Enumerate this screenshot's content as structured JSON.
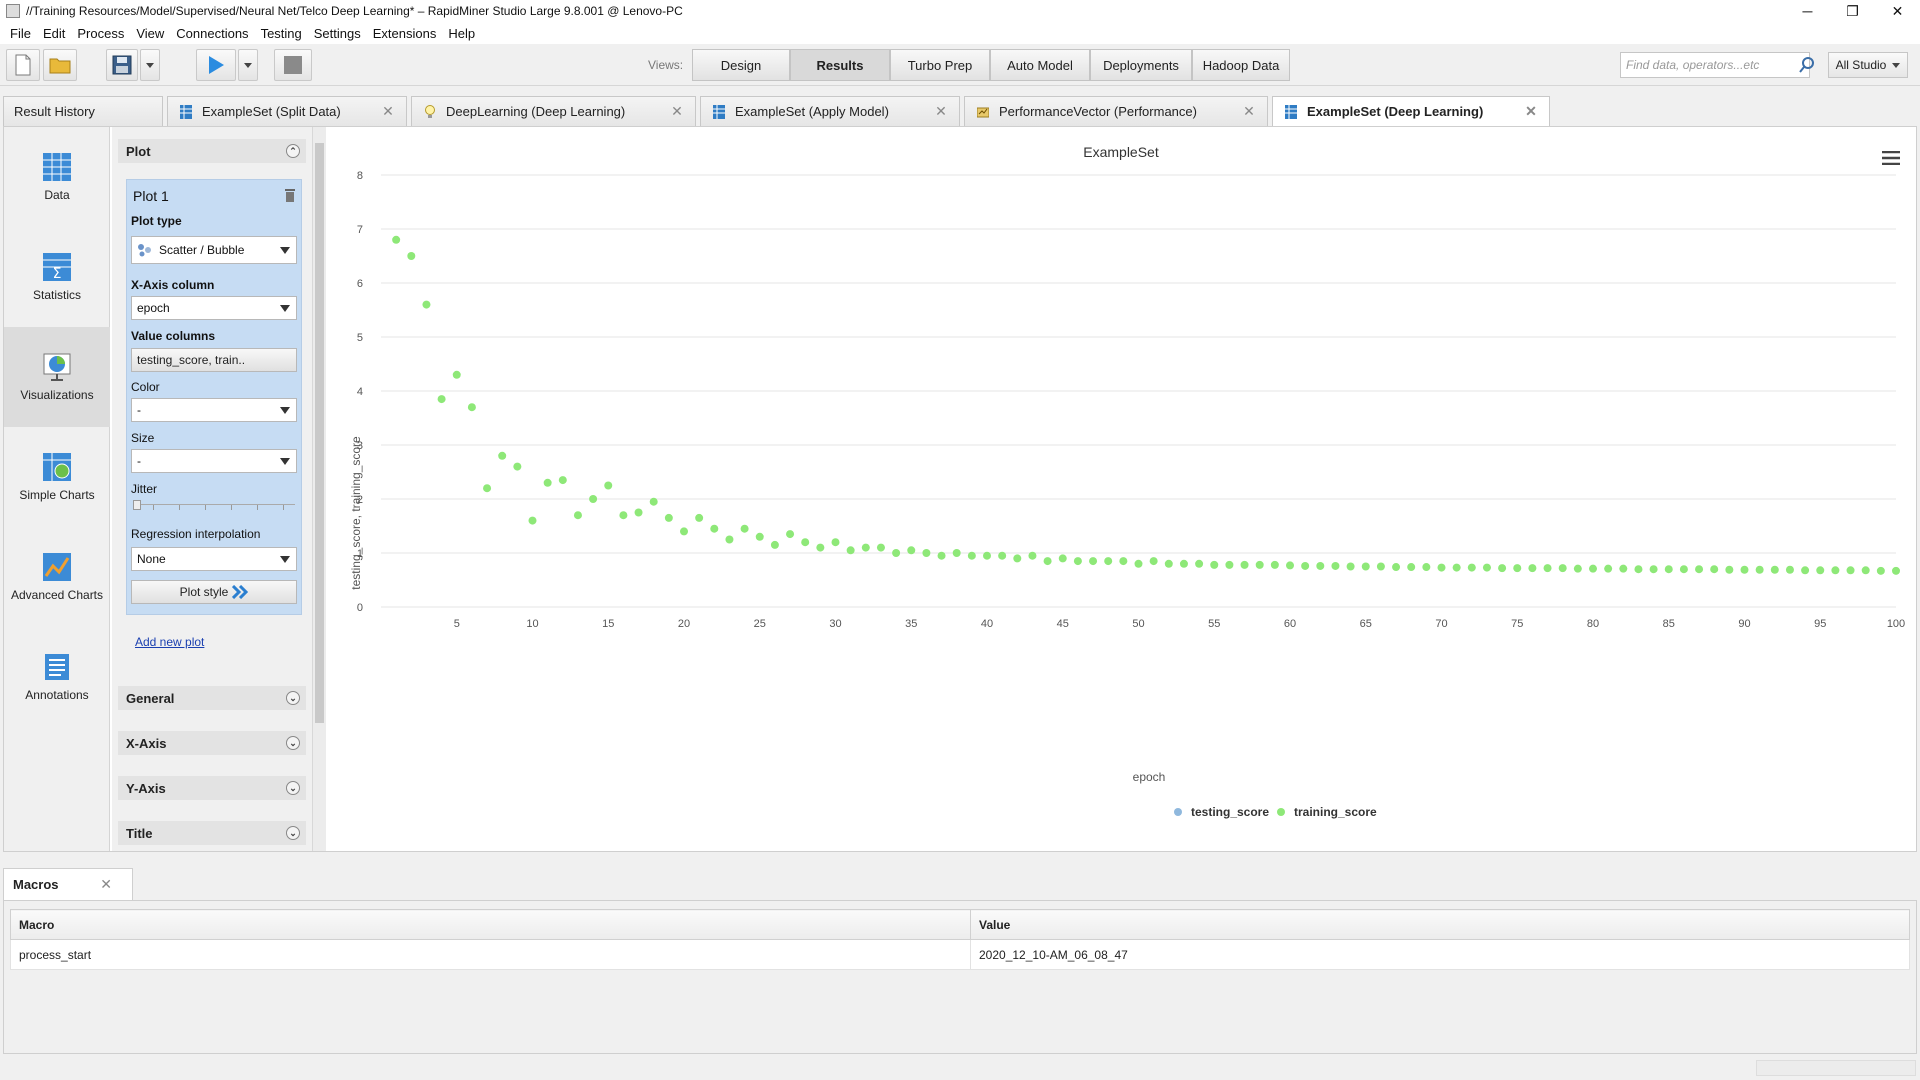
{
  "window": {
    "title": "//Training Resources/Model/Supervised/Neural Net/Telco Deep Learning* – RapidMiner Studio Large 9.8.001 @ Lenovo-PC",
    "minimize": "─",
    "maximize": "❐",
    "close": "✕"
  },
  "menu": [
    "File",
    "Edit",
    "Process",
    "View",
    "Connections",
    "Testing",
    "Settings",
    "Extensions",
    "Help"
  ],
  "toolbar": {
    "views_label": "Views:",
    "views": [
      "Design",
      "Results",
      "Turbo Prep",
      "Auto Model",
      "Deployments",
      "Hadoop Data"
    ],
    "active_view": "Results",
    "search_placeholder": "Find data, operators...etc",
    "studio_select": "All Studio"
  },
  "tabs": [
    {
      "label": "Result History",
      "active": false
    },
    {
      "label": "ExampleSet (Split Data)",
      "active": false
    },
    {
      "label": "DeepLearning (Deep Learning)",
      "active": false
    },
    {
      "label": "ExampleSet (Apply Model)",
      "active": false
    },
    {
      "label": "PerformanceVector (Performance)",
      "active": false
    },
    {
      "label": "ExampleSet (Deep Learning)",
      "active": true
    }
  ],
  "left_nav": [
    {
      "label": "Data"
    },
    {
      "label": "Statistics"
    },
    {
      "label": "Visualizations",
      "active": true
    },
    {
      "label": "Simple Charts"
    },
    {
      "label": "Advanced Charts"
    },
    {
      "label": "Annotations"
    }
  ],
  "settings": {
    "plot_section": "Plot",
    "plot_title": "Plot 1",
    "plot_type_label": "Plot type",
    "plot_type_value": "Scatter / Bubble",
    "x_axis_label": "X-Axis column",
    "x_axis_value": "epoch",
    "value_columns_label": "Value columns",
    "value_columns_value": "testing_score, train..",
    "color_label": "Color",
    "color_value": "-",
    "size_label": "Size",
    "size_value": "-",
    "jitter_label": "Jitter",
    "regression_label": "Regression interpolation",
    "regression_value": "None",
    "plot_style_button": "Plot style",
    "add_new_plot": "Add new plot",
    "sections": [
      "General",
      "X-Axis",
      "Y-Axis",
      "Title"
    ]
  },
  "chart_data": {
    "type": "scatter",
    "title": "ExampleSet",
    "xlabel": "epoch",
    "ylabel": "testing_score, training_score",
    "xlim": [
      0,
      100
    ],
    "ylim": [
      0,
      8
    ],
    "x_ticks": [
      5,
      10,
      15,
      20,
      25,
      30,
      35,
      40,
      45,
      50,
      55,
      60,
      65,
      70,
      75,
      80,
      85,
      90,
      95,
      100
    ],
    "y_ticks": [
      0,
      1,
      2,
      3,
      4,
      5,
      6,
      7,
      8
    ],
    "grid": true,
    "legend_position": "bottom-center",
    "series": [
      {
        "name": "testing_score",
        "color": "#8fb8dd",
        "x": [],
        "y": []
      },
      {
        "name": "training_score",
        "color": "#8ee878",
        "x": [
          1,
          2,
          3,
          4,
          5,
          6,
          7,
          8,
          9,
          10,
          11,
          12,
          13,
          14,
          15,
          16,
          17,
          18,
          19,
          20,
          21,
          22,
          23,
          24,
          25,
          26,
          27,
          28,
          29,
          30,
          31,
          32,
          33,
          34,
          35,
          36,
          37,
          38,
          39,
          40,
          41,
          42,
          43,
          44,
          45,
          46,
          47,
          48,
          49,
          50,
          51,
          52,
          53,
          54,
          55,
          56,
          57,
          58,
          59,
          60,
          61,
          62,
          63,
          64,
          65,
          66,
          67,
          68,
          69,
          70,
          71,
          72,
          73,
          74,
          75,
          76,
          77,
          78,
          79,
          80,
          81,
          82,
          83,
          84,
          85,
          86,
          87,
          88,
          89,
          90,
          91,
          92,
          93,
          94,
          95,
          96,
          97,
          98,
          99,
          100
        ],
        "y": [
          6.8,
          6.5,
          5.6,
          3.85,
          4.3,
          3.7,
          2.2,
          2.8,
          2.6,
          1.6,
          2.3,
          2.35,
          1.7,
          2.0,
          2.25,
          1.7,
          1.75,
          1.95,
          1.65,
          1.4,
          1.65,
          1.45,
          1.25,
          1.45,
          1.3,
          1.15,
          1.35,
          1.2,
          1.1,
          1.2,
          1.05,
          1.1,
          1.1,
          1.0,
          1.05,
          1.0,
          0.95,
          1.0,
          0.95,
          0.95,
          0.95,
          0.9,
          0.95,
          0.85,
          0.9,
          0.85,
          0.85,
          0.85,
          0.85,
          0.8,
          0.85,
          0.8,
          0.8,
          0.8,
          0.78,
          0.78,
          0.78,
          0.78,
          0.78,
          0.77,
          0.76,
          0.76,
          0.76,
          0.75,
          0.75,
          0.75,
          0.74,
          0.74,
          0.74,
          0.73,
          0.73,
          0.73,
          0.73,
          0.72,
          0.72,
          0.72,
          0.72,
          0.72,
          0.71,
          0.71,
          0.71,
          0.71,
          0.7,
          0.7,
          0.7,
          0.7,
          0.7,
          0.7,
          0.69,
          0.69,
          0.69,
          0.69,
          0.69,
          0.68,
          0.68,
          0.68,
          0.68,
          0.68,
          0.67,
          0.67
        ]
      }
    ]
  },
  "macros": {
    "tab_label": "Macros",
    "columns": [
      "Macro",
      "Value"
    ],
    "rows": [
      [
        "process_start",
        "2020_12_10-AM_06_08_47"
      ]
    ]
  }
}
